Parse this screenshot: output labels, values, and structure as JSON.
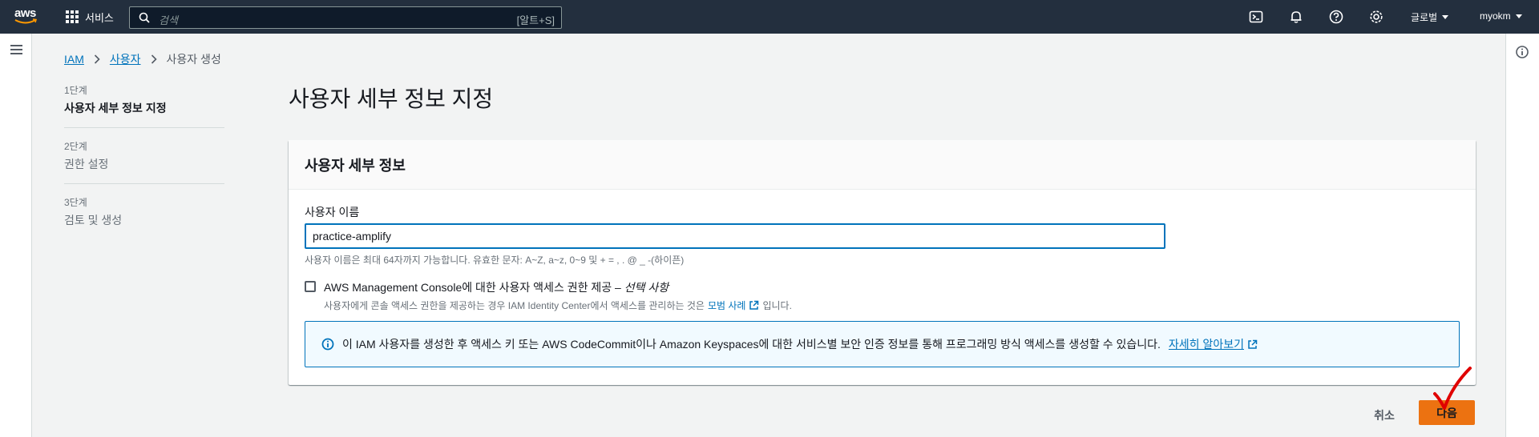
{
  "topnav": {
    "logo_text": "aws",
    "services_label": "서비스",
    "search_placeholder": "검색",
    "search_shortcut": "[알트+S]",
    "region_label": "글로벌",
    "user_label": "myokm"
  },
  "breadcrumb": {
    "items": [
      "IAM",
      "사용자"
    ],
    "current": "사용자 생성"
  },
  "steps": [
    {
      "num": "1단계",
      "name": "사용자 세부 정보 지정",
      "active": true
    },
    {
      "num": "2단계",
      "name": "권한 설정",
      "active": false
    },
    {
      "num": "3단계",
      "name": "검토 및 생성",
      "active": false
    }
  ],
  "page": {
    "title": "사용자 세부 정보 지정"
  },
  "panel": {
    "header": "사용자 세부 정보",
    "field_label": "사용자 이름",
    "field_value": "practice-amplify",
    "constraint": "사용자 이름은 최대 64자까지 가능합니다. 유효한 문자: A~Z, a~z, 0~9 및 + = , . @ _ -(하이픈)",
    "checkbox_label_main": "AWS Management Console에 대한 사용자 액세스 권한 제공 – ",
    "checkbox_label_optional": "선택 사항",
    "checkbox_checked": false,
    "checkbox_desc_prefix": "사용자에게 콘솔 액세스 권한을 제공하는 경우 IAM Identity Center에서 액세스를 관리하는 것은 ",
    "checkbox_desc_link": "모범 사례",
    "checkbox_desc_suffix": "입니다.",
    "alert_text": "이 IAM 사용자를 생성한 후 액세스 키 또는 AWS CodeCommit이나 Amazon Keyspaces에 대한 서비스별 보안 인증 정보를 통해 프로그래밍 방식 액세스를 생성할 수 있습니다.",
    "alert_link": "자세히 알아보기"
  },
  "footer": {
    "cancel_label": "취소",
    "next_label": "다음"
  },
  "colors": {
    "nav_bg": "#232f3e",
    "link": "#0073bb",
    "primary_button": "#ec7211",
    "check_mark": "#e00000"
  }
}
